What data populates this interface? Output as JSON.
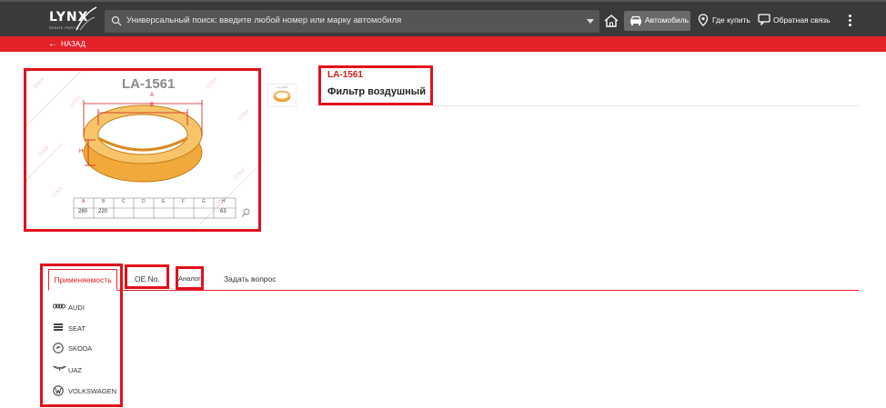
{
  "header": {
    "logo_text": "LYNX",
    "logo_sub": "SPARE PARTS",
    "search_placeholder": "Универсальный поиск: введите любой номер или марку автомобиля",
    "car_button": "Автомобиль",
    "where_buy": "Где купить",
    "feedback": "Обратная связь"
  },
  "subbar": {
    "back": "НАЗАД"
  },
  "product": {
    "image_title": "LA-1561",
    "sku": "LA-1561",
    "name": "Фильтр воздушный",
    "dims": {
      "labels": [
        "A",
        "B",
        "C",
        "D",
        "E",
        "F",
        "G",
        "H"
      ],
      "values": [
        "280",
        "220",
        "",
        "",
        "",
        "",
        "",
        "63"
      ],
      "drawing_labels": [
        "A",
        "B",
        "H"
      ]
    }
  },
  "tabs": [
    {
      "label": "Применяемость",
      "active": true
    },
    {
      "label": "OE No.",
      "active": false
    },
    {
      "label": "Аналог",
      "active": false
    },
    {
      "label": "Задать вопрос",
      "active": false
    }
  ],
  "brands": [
    {
      "name": "AUDI",
      "icon": "audi-rings-icon"
    },
    {
      "name": "SEAT",
      "icon": "seat-logo-icon"
    },
    {
      "name": "SKODA",
      "icon": "skoda-logo-icon"
    },
    {
      "name": "UAZ",
      "icon": "uaz-logo-icon"
    },
    {
      "name": "VOLKSWAGEN",
      "icon": "vw-logo-icon"
    }
  ],
  "colors": {
    "accent": "#e3222a",
    "topbar": "#3a3a3a",
    "filter_orange": "#f2a93b"
  }
}
